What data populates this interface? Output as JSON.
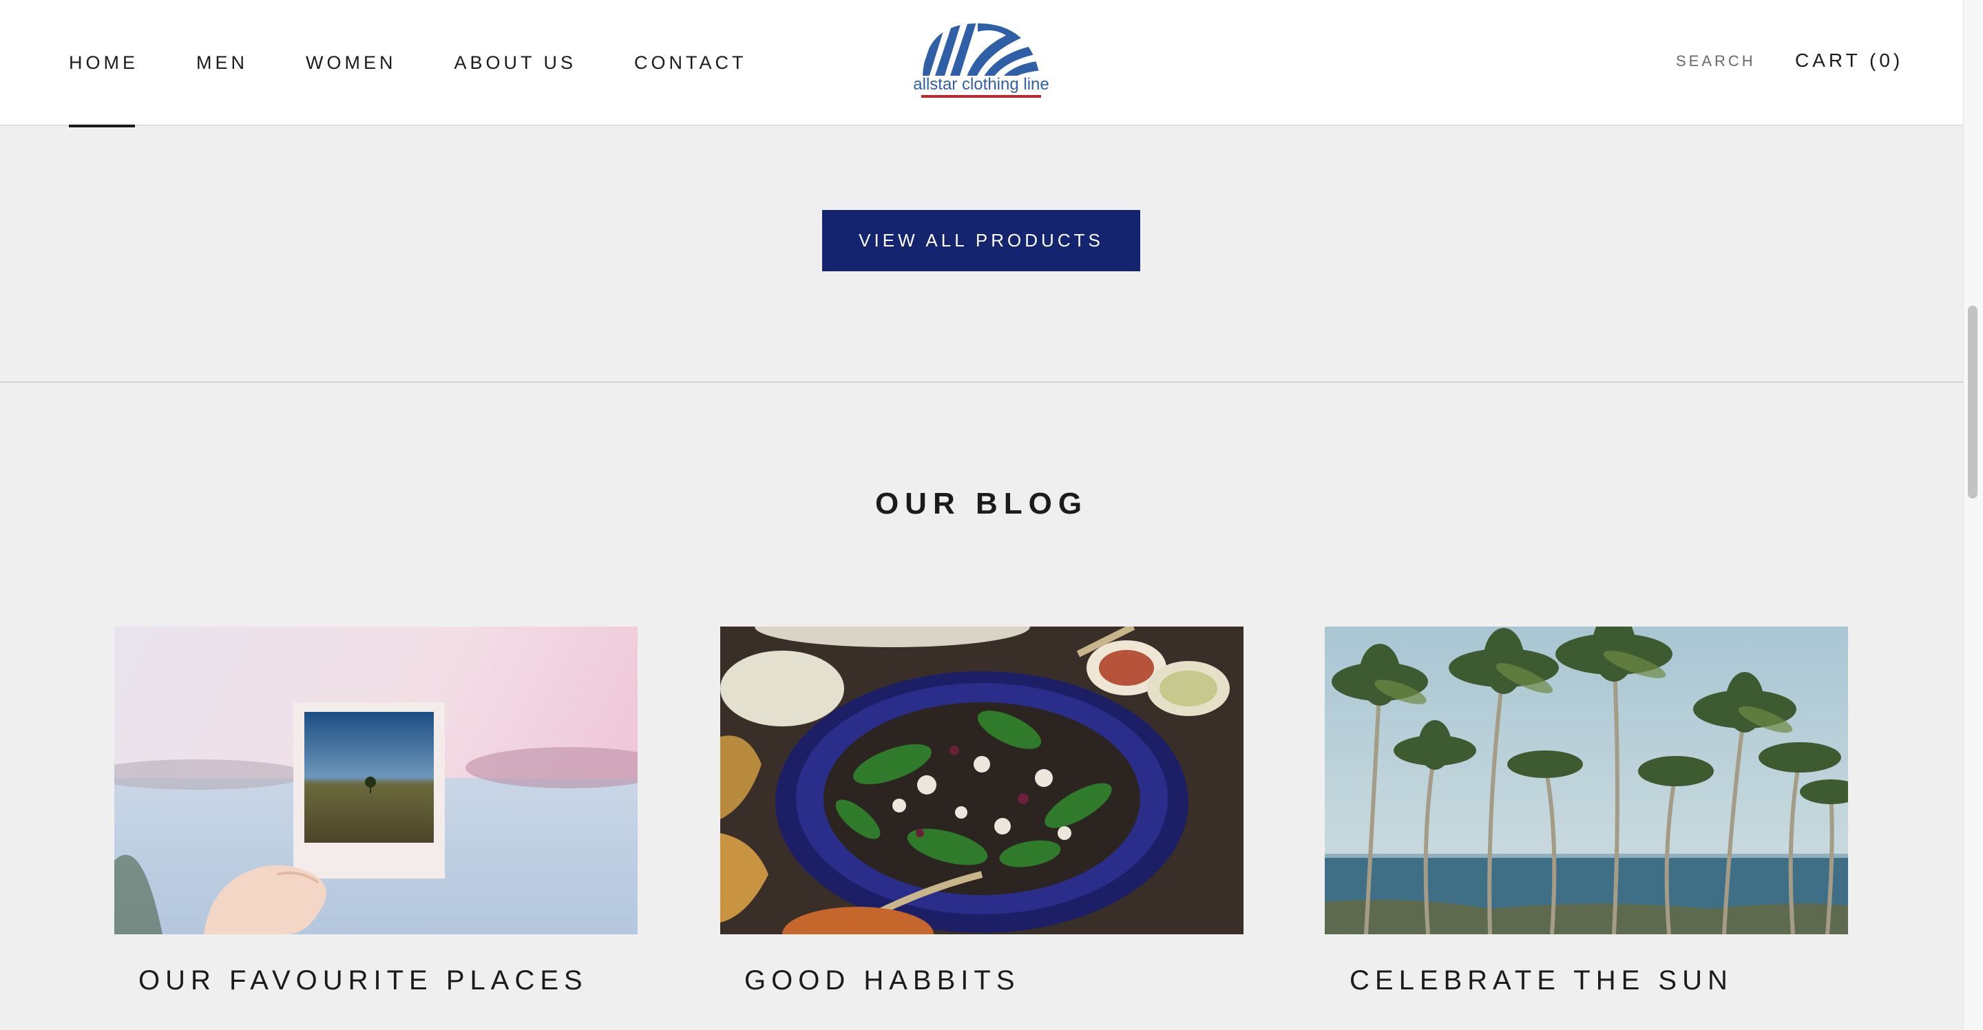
{
  "header": {
    "nav": [
      {
        "label": "HOME",
        "active": true
      },
      {
        "label": "MEN",
        "active": false
      },
      {
        "label": "WOMEN",
        "active": false
      },
      {
        "label": "ABOUT US",
        "active": false
      },
      {
        "label": "CONTACT",
        "active": false
      }
    ],
    "logo_text": "allstar clothing line",
    "logo_colors": {
      "stripes": "#2f5fa7",
      "underline": "#c0262d"
    },
    "search_label": "SEARCH",
    "cart_label": "CART (0)"
  },
  "products": {
    "view_all_label": "VIEW ALL PRODUCTS",
    "button_color": "#14246f"
  },
  "blog": {
    "title": "OUR BLOG",
    "posts": [
      {
        "title": "OUR FAVOURITE PLACES",
        "image": "polaroid-photo-image"
      },
      {
        "title": "GOOD HABBITS",
        "image": "salad-bowl-image"
      },
      {
        "title": "CELEBRATE THE SUN",
        "image": "palm-trees-image"
      }
    ]
  }
}
